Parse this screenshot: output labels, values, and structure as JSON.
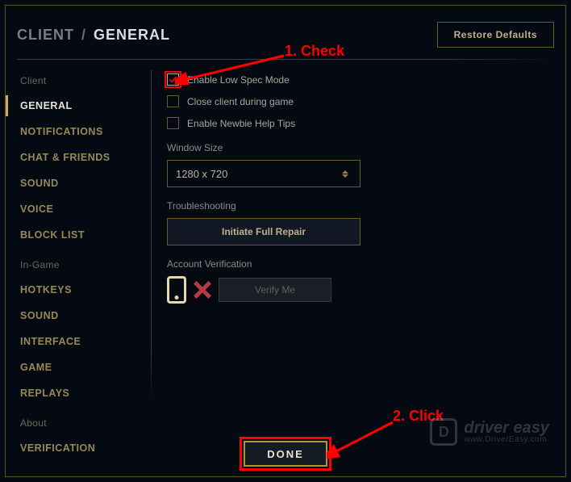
{
  "breadcrumb": {
    "root": "CLIENT",
    "sep": "/",
    "current": "GENERAL"
  },
  "restore_defaults_label": "Restore Defaults",
  "sidebar": {
    "group_client": "Client",
    "client_items": [
      "GENERAL",
      "NOTIFICATIONS",
      "CHAT & FRIENDS",
      "SOUND",
      "VOICE",
      "BLOCK LIST"
    ],
    "group_ingame": "In-Game",
    "ingame_items": [
      "HOTKEYS",
      "SOUND",
      "INTERFACE",
      "GAME",
      "REPLAYS"
    ],
    "group_about": "About",
    "about_items": [
      "VERIFICATION"
    ]
  },
  "checks": {
    "low_spec": {
      "label": "Enable Low Spec Mode",
      "checked": true
    },
    "close_client": {
      "label": "Close client during game",
      "checked": false
    },
    "newbie": {
      "label": "Enable Newbie Help Tips",
      "checked": false
    }
  },
  "window_size": {
    "label": "Window Size",
    "value": "1280 x 720"
  },
  "troubleshooting": {
    "label": "Troubleshooting",
    "button": "Initiate Full Repair"
  },
  "account_verification": {
    "label": "Account Verification",
    "button": "Verify Me"
  },
  "done_label": "DONE",
  "annotations": {
    "one": "1. Check",
    "two": "2. Click"
  },
  "watermark": {
    "brand": "driver easy",
    "site": "www.DriverEasy.com"
  }
}
